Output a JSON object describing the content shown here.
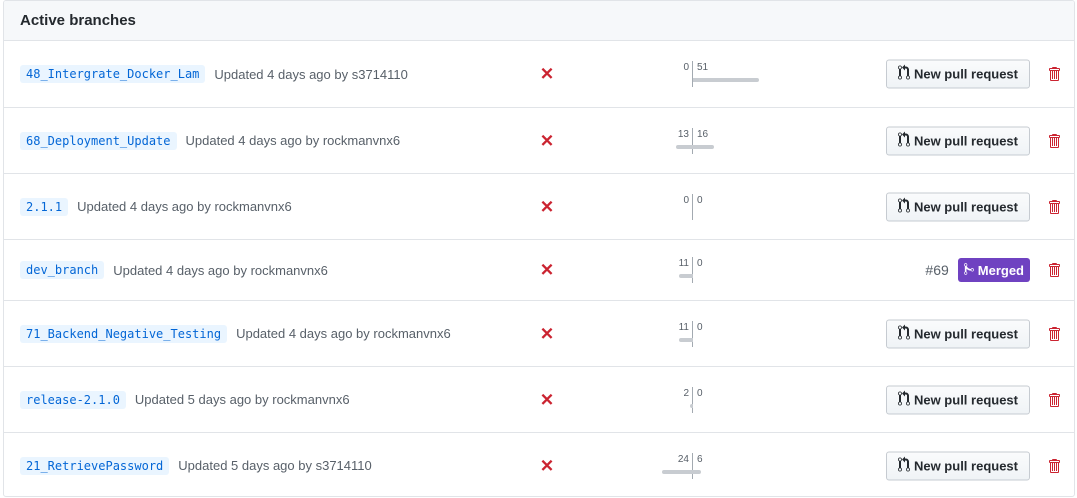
{
  "header": {
    "title": "Active branches"
  },
  "branches": [
    {
      "name": "48_Intergrate_Docker_Lam",
      "updated": "Updated 4 days ago by s3714110",
      "behind": 0,
      "ahead": 51,
      "action": "new-pr",
      "action_label": "New pull request"
    },
    {
      "name": "68_Deployment_Update",
      "updated": "Updated 4 days ago by rockmanvnx6",
      "behind": 13,
      "ahead": 16,
      "action": "new-pr",
      "action_label": "New pull request"
    },
    {
      "name": "2.1.1",
      "updated": "Updated 4 days ago by rockmanvnx6",
      "behind": 0,
      "ahead": 0,
      "action": "new-pr",
      "action_label": "New pull request"
    },
    {
      "name": "dev_branch",
      "updated": "Updated 4 days ago by rockmanvnx6",
      "behind": 11,
      "ahead": 0,
      "action": "merged",
      "pr_number": "#69",
      "merged_label": "Merged"
    },
    {
      "name": "71_Backend_Negative_Testing",
      "updated": "Updated 4 days ago by rockmanvnx6",
      "behind": 11,
      "ahead": 0,
      "action": "new-pr",
      "action_label": "New pull request"
    },
    {
      "name": "release-2.1.0",
      "updated": "Updated 5 days ago by rockmanvnx6",
      "behind": 2,
      "ahead": 0,
      "action": "new-pr",
      "action_label": "New pull request"
    },
    {
      "name": "21_RetrievePassword",
      "updated": "Updated 5 days ago by s3714110",
      "behind": 24,
      "ahead": 6,
      "action": "new-pr",
      "action_label": "New pull request"
    }
  ],
  "status_icon": {
    "name": "x-icon",
    "glyph": "✕",
    "color": "#cb2431"
  },
  "colors": {
    "link": "#0366d6",
    "merged": "#6f42c1",
    "danger": "#cb2431"
  }
}
